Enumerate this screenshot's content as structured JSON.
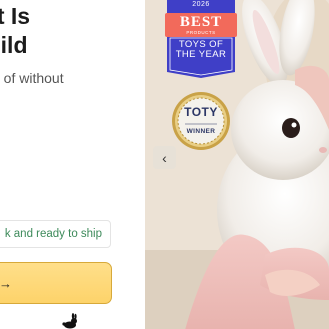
{
  "hero": {
    "headline_line1": "hat Is",
    "headline_line2": "Child",
    "subtext": "g of without"
  },
  "stock": {
    "status": "k and ready to ship"
  },
  "cta": {
    "icon": "arrow-right-icon",
    "arrow_glyph": "→"
  },
  "badges": {
    "best": {
      "year": "2026",
      "title": "BEST",
      "subtitle": "PRODUCTS",
      "award_line1": "TOYS OF",
      "award_line2": "THE YEAR"
    },
    "toty": {
      "logo": "TOTY",
      "label": "WINNER"
    }
  },
  "carousel": {
    "prev_icon": "chevron-left-icon",
    "prev_glyph": "‹"
  },
  "colors": {
    "accent_button": "#fdd36a",
    "stock_text": "#3d8a5a",
    "badge_blue": "#3f3fc7",
    "badge_coral": "#f26a5b"
  }
}
